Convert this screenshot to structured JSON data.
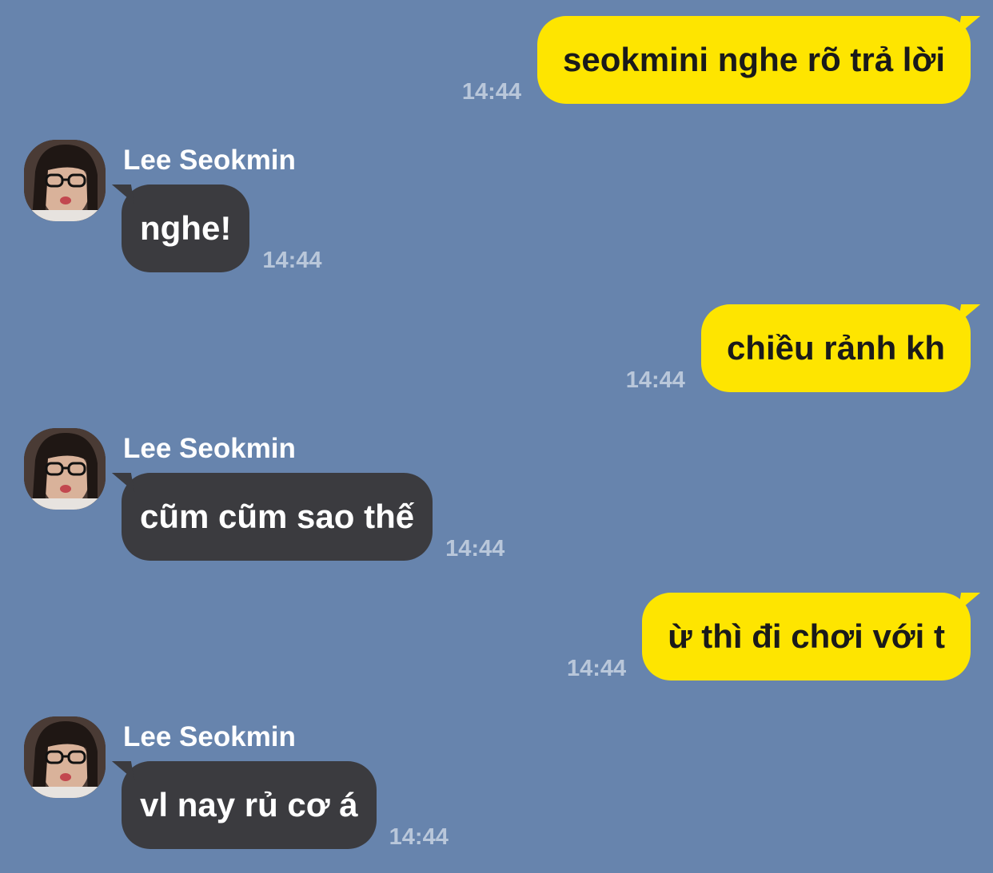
{
  "contact": {
    "name": "Lee Seokmin",
    "avatar_icon": "profile-photo"
  },
  "colors": {
    "background": "#6784ad",
    "outgoing_bubble": "#fee500",
    "incoming_bubble": "#3b3b3f",
    "timestamp": "#b9c7da"
  },
  "messages": [
    {
      "direction": "outgoing",
      "text": "seokmini nghe rõ trả lời",
      "time": "14:44"
    },
    {
      "direction": "incoming",
      "sender": "Lee Seokmin",
      "text": "nghe!",
      "time": "14:44"
    },
    {
      "direction": "outgoing",
      "text": "chiều rảnh kh",
      "time": "14:44"
    },
    {
      "direction": "incoming",
      "sender": "Lee Seokmin",
      "text": "cũm cũm sao thế",
      "time": "14:44"
    },
    {
      "direction": "outgoing",
      "text": "ừ thì đi chơi với t",
      "time": "14:44"
    },
    {
      "direction": "incoming",
      "sender": "Lee Seokmin",
      "text": "vl nay rủ cơ á",
      "time": "14:44"
    }
  ]
}
